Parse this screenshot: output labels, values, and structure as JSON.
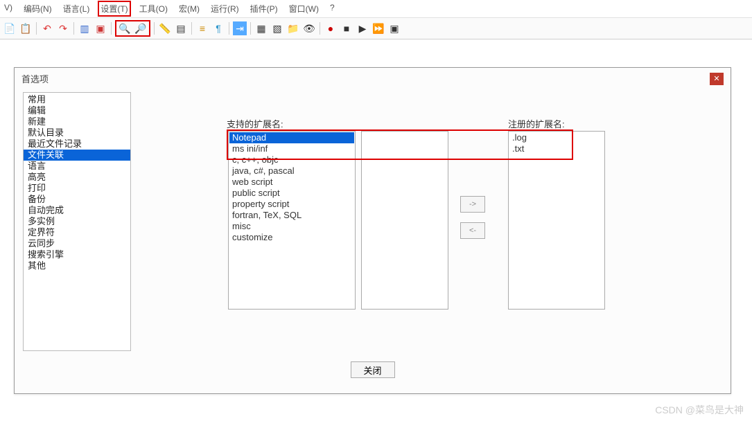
{
  "menubar": {
    "items": [
      "V)",
      "编码(N)",
      "语言(L)",
      "设置(T)",
      "工具(O)",
      "宏(M)",
      "运行(R)",
      "插件(P)",
      "窗口(W)",
      "?"
    ],
    "highlighted_index": 3
  },
  "toolbar": {
    "icons": [
      "file",
      "copy",
      "undo",
      "redo",
      "chart",
      "marker",
      "zoom-in",
      "zoom-out",
      "ruler",
      "grid",
      "list",
      "pilcrow",
      "indent",
      "table",
      "format",
      "format2",
      "folder",
      "eye",
      "record",
      "stop",
      "play",
      "fast-forward",
      "text-record"
    ],
    "highlight_start": 6,
    "highlight_end": 7
  },
  "dialog": {
    "title": "首选项",
    "close_label": "✕"
  },
  "sidebar": {
    "items": [
      "常用",
      "编辑",
      "新建",
      "默认目录",
      "最近文件记录",
      "文件关联",
      "语言",
      "高亮",
      "打印",
      "备份",
      "自动完成",
      "多实例",
      "定界符",
      "云同步",
      "搜索引擎",
      "其他"
    ],
    "selected_index": 5
  },
  "labels": {
    "supported": "支持的扩展名:",
    "registered": "注册的扩展名:"
  },
  "supported_extensions": {
    "items": [
      "Notepad",
      "ms ini/inf",
      "c, c++, objc",
      "java, c#, pascal",
      "web script",
      "public script",
      "property script",
      "fortran, TeX, SQL",
      "misc",
      "customize"
    ],
    "selected_index": 0
  },
  "registered_extensions": {
    "items": [
      ".log",
      ".txt"
    ]
  },
  "buttons": {
    "arrow_right": "->",
    "arrow_left": "<-",
    "close": "关闭"
  },
  "watermark": "CSDN @菜鸟是大神"
}
